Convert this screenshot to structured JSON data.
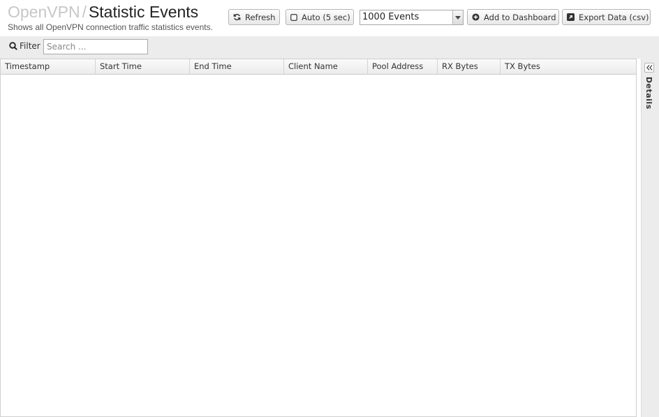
{
  "header": {
    "breadcrumb": "OpenVPN",
    "separator": "/",
    "title": "Statistic Events",
    "subtitle": "Shows all OpenVPN connection traffic statistics events."
  },
  "toolbar": {
    "refresh_label": "Refresh",
    "auto_label": "Auto (5 sec)",
    "events_select_value": "1000 Events",
    "add_dashboard_label": "Add to Dashboard",
    "export_label": "Export Data (csv)"
  },
  "filter": {
    "label": "Filter",
    "placeholder": "Search ..."
  },
  "table": {
    "columns": [
      "Timestamp",
      "Start Time",
      "End Time",
      "Client Name",
      "Pool Address",
      "RX Bytes",
      "TX Bytes"
    ],
    "rows": []
  },
  "details_panel": {
    "label": "Details"
  }
}
